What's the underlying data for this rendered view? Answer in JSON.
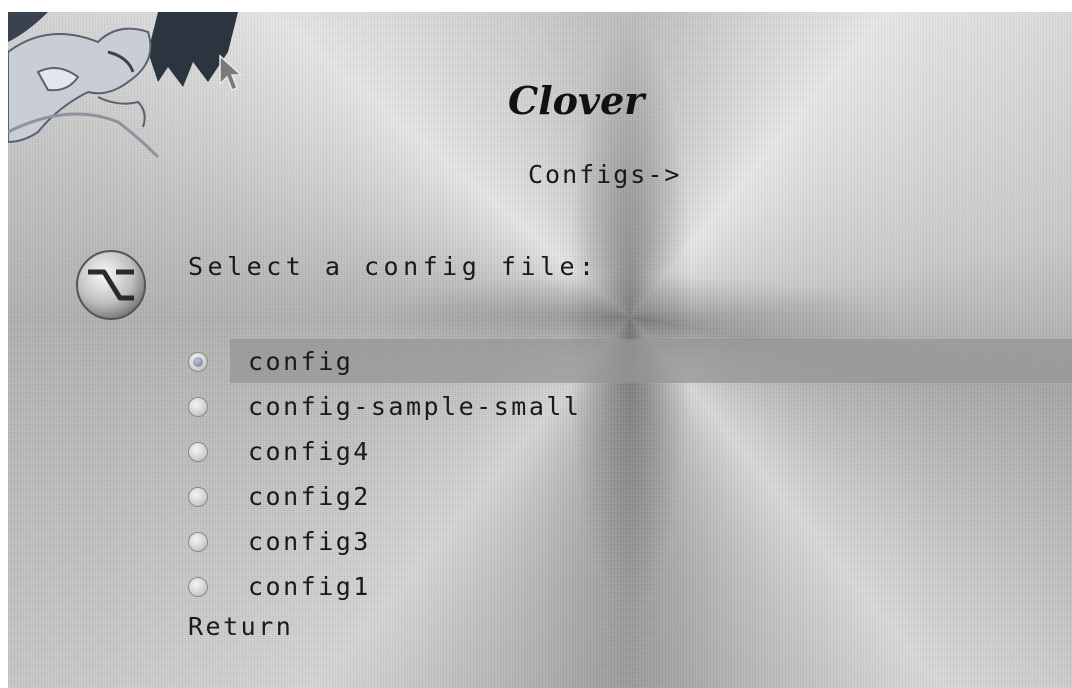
{
  "app": {
    "title": "Clover",
    "breadcrumb": "Configs->"
  },
  "menu": {
    "prompt": "Select a config file:",
    "icon": "options-switch-icon",
    "selected_index": 0,
    "options": [
      {
        "label": "config",
        "selected": true
      },
      {
        "label": "config-sample-small",
        "selected": false
      },
      {
        "label": "config4",
        "selected": false
      },
      {
        "label": "config2",
        "selected": false
      },
      {
        "label": "config3",
        "selected": false
      },
      {
        "label": "config1",
        "selected": false
      }
    ],
    "return_label": "Return"
  },
  "decor": {
    "logo": "dragon-logo",
    "cursor": "mouse-pointer-icon"
  }
}
